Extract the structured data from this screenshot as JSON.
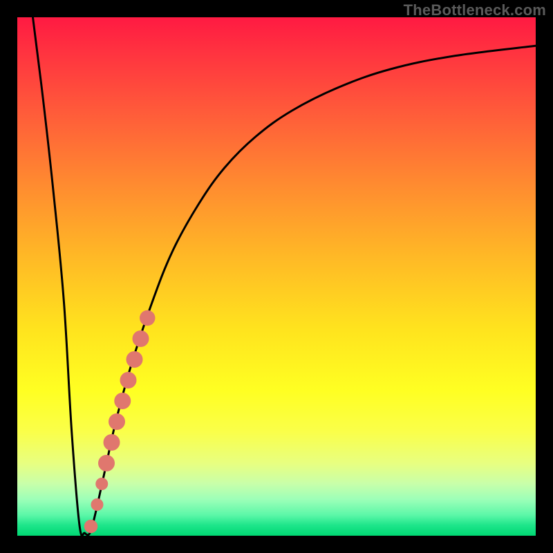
{
  "watermark": "TheBottleneck.com",
  "chart_data": {
    "type": "line",
    "title": "",
    "xlabel": "",
    "ylabel": "",
    "xlim": [
      0,
      100
    ],
    "ylim": [
      0,
      100
    ],
    "grid": false,
    "legend": false,
    "background_gradient": {
      "top": "#ff1a42",
      "bottom": "#00d873",
      "description": "vertical red-to-green heat gradient"
    },
    "series": [
      {
        "name": "bottleneck-curve",
        "color": "#000000",
        "x": [
          3,
          5,
          7,
          9,
          10.5,
          12,
          13,
          14,
          15,
          17,
          19,
          22,
          26,
          30,
          35,
          40,
          46,
          53,
          62,
          72,
          84,
          100
        ],
        "y": [
          100,
          84,
          66,
          45,
          20,
          2,
          0.5,
          0.5,
          4,
          13,
          22,
          33,
          45,
          55,
          64,
          71,
          77,
          82,
          86.5,
          90,
          92.5,
          94.5
        ]
      }
    ],
    "markers": [
      {
        "name": "cluster-point",
        "color": "#e0776e",
        "x": 14.2,
        "y": 1.8,
        "r": 1.3
      },
      {
        "name": "cluster-point",
        "color": "#e0776e",
        "x": 15.4,
        "y": 6.0,
        "r": 1.2
      },
      {
        "name": "cluster-point",
        "color": "#e0776e",
        "x": 16.3,
        "y": 10.0,
        "r": 1.2
      },
      {
        "name": "cluster-point",
        "color": "#e0776e",
        "x": 17.2,
        "y": 14.0,
        "r": 1.6
      },
      {
        "name": "cluster-point",
        "color": "#e0776e",
        "x": 18.2,
        "y": 18.0,
        "r": 1.6
      },
      {
        "name": "cluster-point",
        "color": "#e0776e",
        "x": 19.2,
        "y": 22.0,
        "r": 1.6
      },
      {
        "name": "cluster-point",
        "color": "#e0776e",
        "x": 20.3,
        "y": 26.0,
        "r": 1.6
      },
      {
        "name": "cluster-point",
        "color": "#e0776e",
        "x": 21.4,
        "y": 30.0,
        "r": 1.6
      },
      {
        "name": "cluster-point",
        "color": "#e0776e",
        "x": 22.6,
        "y": 34.0,
        "r": 1.6
      },
      {
        "name": "cluster-point",
        "color": "#e0776e",
        "x": 23.8,
        "y": 38.0,
        "r": 1.6
      },
      {
        "name": "cluster-point",
        "color": "#e0776e",
        "x": 25.1,
        "y": 42.0,
        "r": 1.5
      }
    ]
  }
}
